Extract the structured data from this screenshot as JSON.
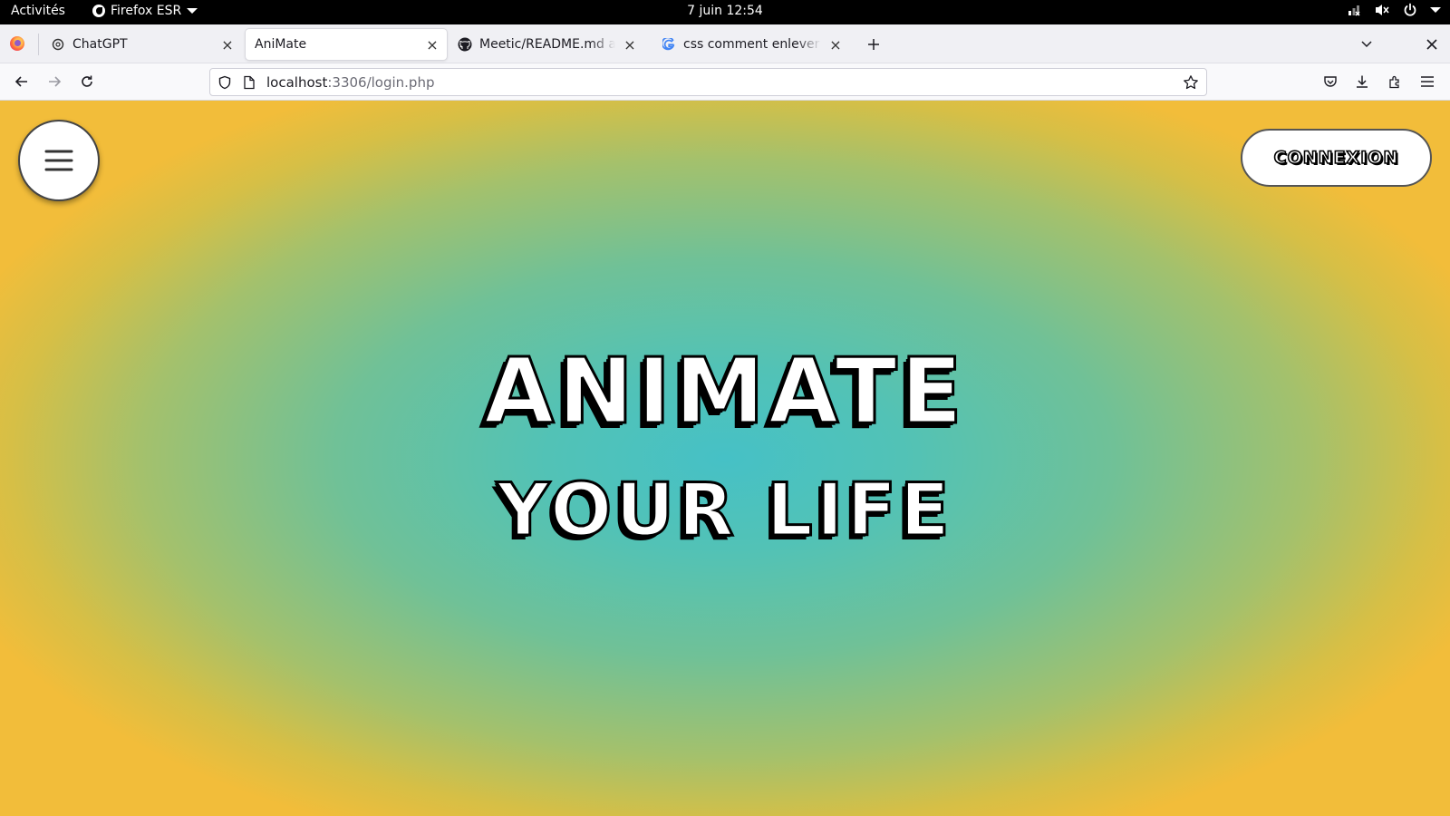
{
  "system_bar": {
    "activities": "Activités",
    "app_name": "Firefox ESR",
    "clock": "7 juin  12:54",
    "status_icons": [
      "network-icon",
      "volume-muted-icon",
      "power-icon"
    ]
  },
  "tabs": [
    {
      "title": "ChatGPT",
      "icon": "chatgpt-icon",
      "active": false
    },
    {
      "title": "AniMate",
      "icon": "",
      "active": true
    },
    {
      "title": "Meetic/README.md at main",
      "icon": "github-icon",
      "active": false
    },
    {
      "title": "css comment enlever le lien",
      "icon": "google-icon",
      "active": false
    }
  ],
  "navbar": {
    "url_host": "localhost",
    "url_path": ":3306/login.php"
  },
  "page": {
    "connexion_label": "CONNEXION",
    "hero_line1": "ANIMATE",
    "hero_line2": "YOUR LIFE"
  },
  "colors": {
    "gradient_center": "#46c1c6",
    "gradient_edge": "#f2bd3a"
  }
}
